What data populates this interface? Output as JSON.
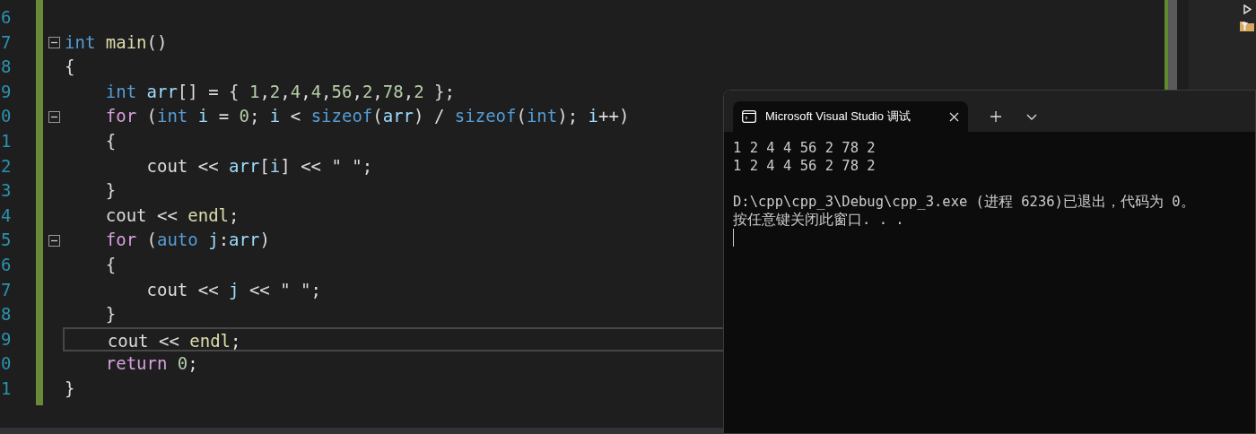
{
  "editor": {
    "lines": [
      {
        "number": "6",
        "collapsible": false
      },
      {
        "number": "7",
        "collapsible": true,
        "current": false,
        "tokens": [
          {
            "kind": "keyword",
            "text": "int"
          },
          {
            "kind": "function",
            "text": " main"
          },
          {
            "kind": "plain",
            "text": "()"
          }
        ]
      },
      {
        "number": "8",
        "collapsible": false,
        "current": false,
        "tokens": [
          {
            "kind": "plain",
            "text": "{"
          }
        ]
      },
      {
        "number": "9",
        "collapsible": false,
        "current": false,
        "tokens": [
          {
            "kind": "keyword",
            "text": "    int"
          },
          {
            "kind": "variable",
            "text": " arr"
          },
          {
            "kind": "plain",
            "text": "[] = { "
          },
          {
            "kind": "number",
            "text": "1"
          },
          {
            "kind": "plain",
            "text": ","
          },
          {
            "kind": "number",
            "text": "2"
          },
          {
            "kind": "plain",
            "text": ","
          },
          {
            "kind": "number",
            "text": "4"
          },
          {
            "kind": "plain",
            "text": ","
          },
          {
            "kind": "number",
            "text": "4"
          },
          {
            "kind": "plain",
            "text": ","
          },
          {
            "kind": "number",
            "text": "56"
          },
          {
            "kind": "plain",
            "text": ","
          },
          {
            "kind": "number",
            "text": "2"
          },
          {
            "kind": "plain",
            "text": ","
          },
          {
            "kind": "number",
            "text": "78"
          },
          {
            "kind": "plain",
            "text": ","
          },
          {
            "kind": "number",
            "text": "2"
          },
          {
            "kind": "plain",
            "text": " };"
          }
        ]
      },
      {
        "number": "0",
        "collapsible": true,
        "current": false,
        "tokens": [
          {
            "kind": "control",
            "text": "    for"
          },
          {
            "kind": "plain",
            "text": " ("
          },
          {
            "kind": "keyword",
            "text": "int"
          },
          {
            "kind": "variable",
            "text": " i"
          },
          {
            "kind": "plain",
            "text": " = "
          },
          {
            "kind": "number",
            "text": "0"
          },
          {
            "kind": "plain",
            "text": "; "
          },
          {
            "kind": "variable",
            "text": "i"
          },
          {
            "kind": "plain",
            "text": " < "
          },
          {
            "kind": "keyword",
            "text": "sizeof"
          },
          {
            "kind": "plain",
            "text": "("
          },
          {
            "kind": "variable",
            "text": "arr"
          },
          {
            "kind": "plain",
            "text": ") / "
          },
          {
            "kind": "keyword",
            "text": "sizeof"
          },
          {
            "kind": "plain",
            "text": "("
          },
          {
            "kind": "keyword",
            "text": "int"
          },
          {
            "kind": "plain",
            "text": "); "
          },
          {
            "kind": "variable",
            "text": "i"
          },
          {
            "kind": "plain",
            "text": "++)"
          }
        ]
      },
      {
        "number": "1",
        "collapsible": false,
        "current": false,
        "tokens": [
          {
            "kind": "plain",
            "text": "    {"
          }
        ]
      },
      {
        "number": "2",
        "collapsible": false,
        "current": false,
        "tokens": [
          {
            "kind": "plain",
            "text": "        cout << "
          },
          {
            "kind": "variable",
            "text": "arr"
          },
          {
            "kind": "plain",
            "text": "["
          },
          {
            "kind": "variable",
            "text": "i"
          },
          {
            "kind": "plain",
            "text": "] << \" \";"
          }
        ]
      },
      {
        "number": "3",
        "collapsible": false,
        "current": false,
        "tokens": [
          {
            "kind": "plain",
            "text": "    }"
          }
        ]
      },
      {
        "number": "4",
        "collapsible": false,
        "current": false,
        "tokens": [
          {
            "kind": "plain",
            "text": "    cout << "
          },
          {
            "kind": "function",
            "text": "endl"
          },
          {
            "kind": "plain",
            "text": ";"
          }
        ]
      },
      {
        "number": "5",
        "collapsible": true,
        "current": false,
        "tokens": [
          {
            "kind": "control",
            "text": "    for"
          },
          {
            "kind": "plain",
            "text": " ("
          },
          {
            "kind": "keyword",
            "text": "auto"
          },
          {
            "kind": "variable",
            "text": " j"
          },
          {
            "kind": "plain",
            "text": ":"
          },
          {
            "kind": "variable",
            "text": "arr"
          },
          {
            "kind": "plain",
            "text": ")"
          }
        ]
      },
      {
        "number": "6",
        "collapsible": false,
        "current": false,
        "tokens": [
          {
            "kind": "plain",
            "text": "    {"
          }
        ]
      },
      {
        "number": "7",
        "collapsible": false,
        "current": false,
        "tokens": [
          {
            "kind": "plain",
            "text": "        cout << "
          },
          {
            "kind": "variable",
            "text": "j"
          },
          {
            "kind": "plain",
            "text": " << \" \";"
          }
        ]
      },
      {
        "number": "8",
        "collapsible": false,
        "current": false,
        "tokens": [
          {
            "kind": "plain",
            "text": "    }"
          }
        ]
      },
      {
        "number": "9",
        "collapsible": false,
        "current": true,
        "tokens": [
          {
            "kind": "plain",
            "text": "    cout << "
          },
          {
            "kind": "function",
            "text": "endl"
          },
          {
            "kind": "plain",
            "text": ";"
          }
        ]
      },
      {
        "number": "0",
        "collapsible": false,
        "current": false,
        "tokens": [
          {
            "kind": "control",
            "text": "    return"
          },
          {
            "kind": "number",
            "text": " 0"
          },
          {
            "kind": "plain",
            "text": ";"
          }
        ]
      },
      {
        "number": "1",
        "collapsible": false,
        "current": false,
        "tokens": [
          {
            "kind": "plain",
            "text": "}"
          }
        ]
      }
    ]
  },
  "terminal": {
    "tabs": [
      {
        "title": "Microsoft Visual Studio 调试",
        "selected": true
      }
    ],
    "output": [
      "1 2 4 4 56 2 78 2",
      "1 2 4 4 56 2 78 2"
    ],
    "exit_message": [
      "D:\\cpp\\cpp_3\\Debug\\cpp_3.exe (进程 6236)已退出，代码为 0。",
      "按任意键关闭此窗口. . ."
    ]
  }
}
